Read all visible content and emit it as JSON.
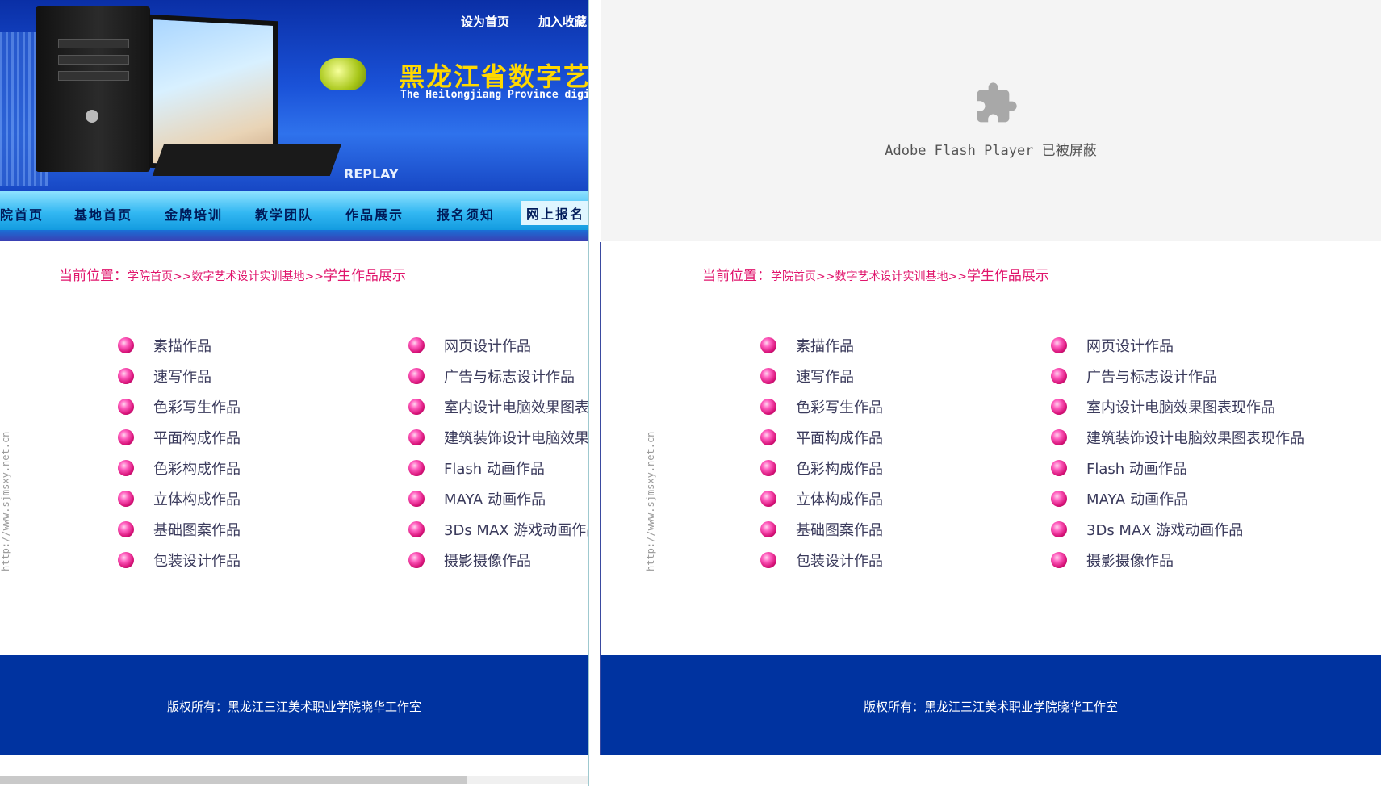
{
  "header": {
    "top_links": [
      "设为首页",
      "加入收藏"
    ],
    "site_title": "黑龙江省数字艺术",
    "site_subtitle": "The Heilongjiang Province digital",
    "replay_label": "REPLAY"
  },
  "nav": {
    "items": [
      "院首页",
      "基地首页",
      "金牌培训",
      "教学团队",
      "作品展示",
      "报名须知",
      "网上报名"
    ],
    "active_index": 6
  },
  "flash": {
    "message": "Adobe Flash Player 已被屏蔽"
  },
  "breadcrumb": {
    "label": "当前位置：",
    "path": "学院首页>>数字艺术设计实训基地>>",
    "current": "学生作品展示"
  },
  "side_url": "http://www.sjmsxy.net.cn",
  "works": {
    "left": [
      "素描作品",
      "速写作品",
      "色彩写生作品",
      "平面构成作品",
      "色彩构成作品",
      "立体构成作品",
      "基础图案作品",
      "包装设计作品"
    ],
    "right": [
      "网页设计作品",
      "广告与标志设计作品",
      "室内设计电脑效果图表现作品",
      "建筑装饰设计电脑效果图表现作品",
      "Flash 动画作品",
      "MAYA 动画作品",
      "3Ds MAX 游戏动画作品",
      "摄影摄像作品"
    ]
  },
  "footer": {
    "copyright": "版权所有：黑龙江三江美术职业学院晓华工作室"
  },
  "colors": {
    "footer_bg": "#0033a0",
    "breadcrumb": "#e0156c",
    "bullet": "#d81379"
  }
}
